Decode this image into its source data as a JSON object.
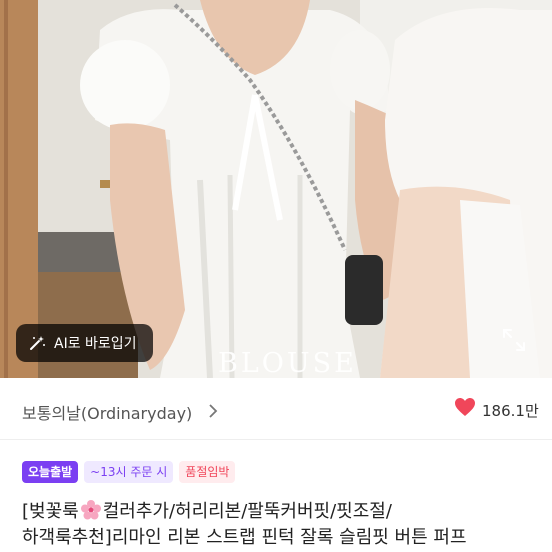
{
  "hero": {
    "watermark": "BLOUSE",
    "ai_button_label": "AI로 바로입기",
    "icons": [
      "magic-wand-icon",
      "expand-icon"
    ]
  },
  "seller": {
    "name": "보통의날(Ordinaryday)",
    "likes": "186.1만"
  },
  "badges": {
    "today": "오늘출발",
    "time": "~13시 주문 시",
    "soldout": "품절임박"
  },
  "title": {
    "line1_a": "[벚꽃룩",
    "line1_b": "컬러추가/허리리본/팔뚝커버핏/핏조절/",
    "line2": "하객룩추천]리마인 리본 스트랩 핀턱 잘록 슬림핏 버튼 퍼프"
  },
  "colors": {
    "accent": "#7b3ff2",
    "heart": "#f0465a"
  }
}
